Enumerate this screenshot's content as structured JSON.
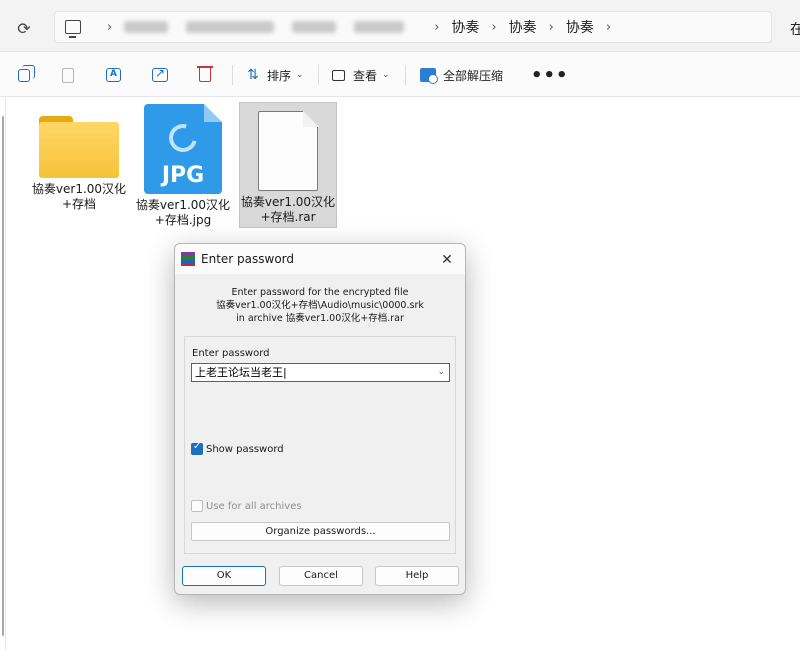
{
  "address_bar": {
    "crumbs": [
      "协奏",
      "协奏",
      "协奏"
    ],
    "overflow_text": "在"
  },
  "command_bar": {
    "sort_label": "排序",
    "view_label": "查看",
    "extract_label": "全部解压缩",
    "more_label": "•••"
  },
  "files": [
    {
      "name_line1": "協奏ver1.00汉化",
      "name_line2": "+存档",
      "icon": "folder-icon"
    },
    {
      "name_line1": "協奏ver1.00汉化",
      "name_line2": "+存档.jpg",
      "icon": "jpg-file-icon",
      "badge": "JPG"
    },
    {
      "name_line1": "協奏ver1.00汉化",
      "name_line2": "+存档.rar",
      "icon": "rar-file-icon"
    }
  ],
  "dialog": {
    "title": "Enter password",
    "info_line1": "Enter password for the encrypted file",
    "info_line2": "協奏ver1.00汉化+存档\\Audio\\music\\0000.srk",
    "info_line3": "in archive 協奏ver1.00汉化+存档.rar",
    "password_label": "Enter password",
    "password_value": "上老王论坛当老王|",
    "show_password_label": "Show password",
    "show_password_checked": true,
    "use_all_label": "Use for all archives",
    "organize_label": "Organize passwords...",
    "ok_label": "OK",
    "cancel_label": "Cancel",
    "help_label": "Help"
  },
  "colors": {
    "accent": "#1f6fbf",
    "folder": "#f7c23a",
    "jpg": "#2f9be8"
  }
}
